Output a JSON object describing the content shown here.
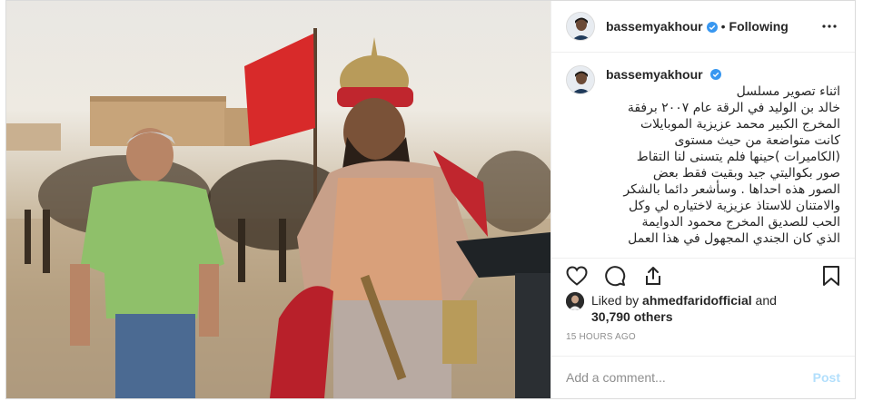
{
  "post": {
    "username": "bassemyakhour",
    "follow_separator": "•",
    "follow_status": "Following",
    "caption": "اثناء تصوير مسلسل\nخالد بن الوليد في الرقة عام ٢٠٠٧ برفقة\nالمخرج الكبير محمد عزيزية الموبايلات\nكانت متواضعة من حيث مستوى\n(الكاميرات )حينها فلم يتسنى لنا التقاط\nصور بكواليتي جيد وبقيت فقط بعض\nالصور هذه احداها . وسأشعر دائما بالشكر\nوالامتنان للاستاذ عزيزية لاختياره لي وكل\nالحب للصديق المخرج محمود الدوايمة\nالذي كان الجندي المجهول في هذا العمل",
    "likes": {
      "prefix": "Liked by",
      "user": "ahmedfaridofficial",
      "connector": "and",
      "count": "30,790 others"
    },
    "timestamp": "15 HOURS AGO",
    "comment_placeholder": "Add a comment...",
    "post_button": "Post"
  },
  "icons": {
    "verified": "verified-badge-icon",
    "more": "more-options-icon",
    "like": "heart-icon",
    "comment": "comment-icon",
    "share": "share-icon",
    "save": "bookmark-icon"
  },
  "colors": {
    "verified_blue": "#3897f0",
    "border": "#dbdbdb",
    "muted": "#8e8e8e",
    "post_button": "#b2dffc",
    "flag_red": "#d82a2a"
  }
}
